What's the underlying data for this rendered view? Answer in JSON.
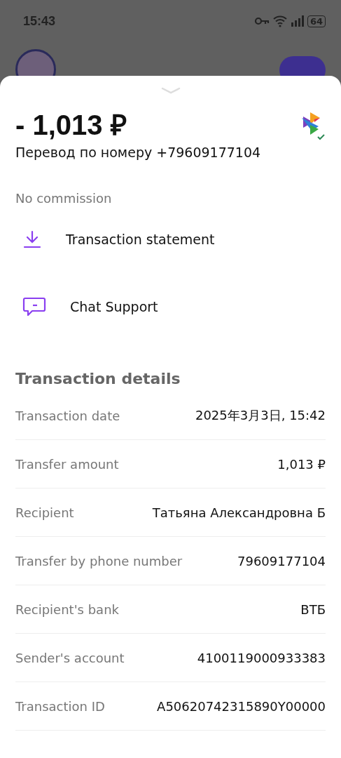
{
  "status_bar": {
    "time": "15:43",
    "battery": "64"
  },
  "sheet": {
    "amount": "- 1,013 ₽",
    "description": "Перевод по номеру +79609177104",
    "commission": "No commission",
    "actions": [
      {
        "kind": "download",
        "label": "Transaction statement"
      },
      {
        "kind": "chat",
        "label": "Chat Support"
      }
    ],
    "details_title": "Transaction details",
    "details": [
      {
        "label": "Transaction date",
        "value": "2025年3月3日, 15:42"
      },
      {
        "label": "Transfer amount",
        "value": "1,013 ₽"
      },
      {
        "label": "Recipient",
        "value": "Татьяна Александровна Б"
      },
      {
        "label": "Transfer by phone number",
        "value": "79609177104"
      },
      {
        "label": "Recipient's bank",
        "value": "ВТБ"
      },
      {
        "label": "Sender's account",
        "value": "4100119000933383"
      },
      {
        "label": "Transaction ID",
        "value": "A50620742315890Y00000"
      }
    ]
  }
}
